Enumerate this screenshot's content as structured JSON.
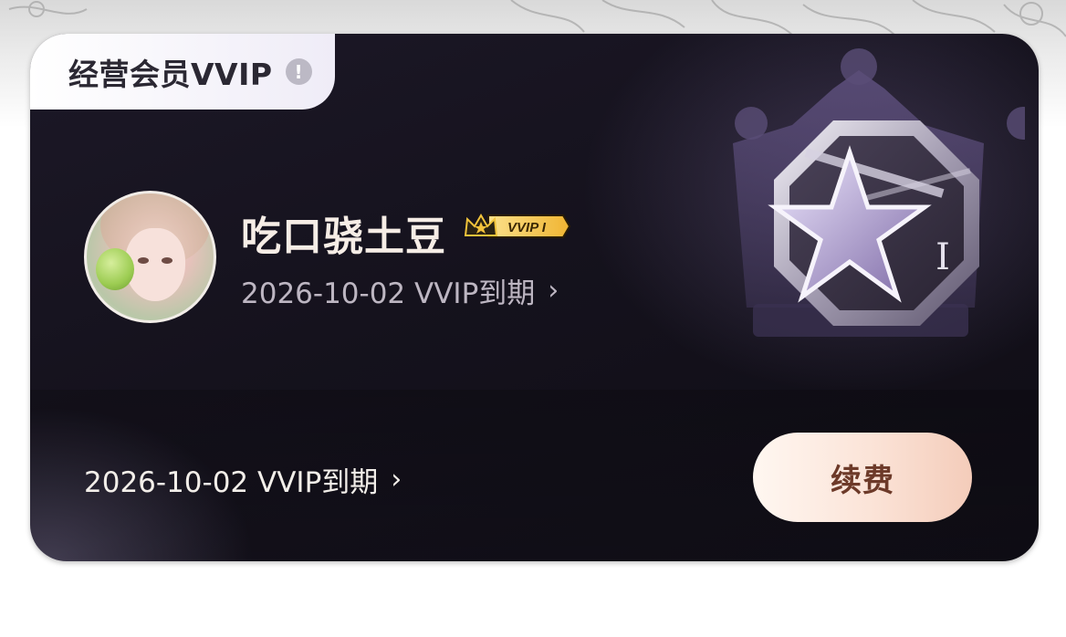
{
  "membership": {
    "tag_label": "经营会员VVIP",
    "tag_info_icon": "info-icon",
    "username": "吃口骁土豆",
    "badge_text": "VVIP I",
    "badge_icon": "crown-icon",
    "expiry_top": "2026-10-02 VVIP到期",
    "expiry_bottom": "2026-10-02 VVIP到期",
    "chevron": "›",
    "renew_label": "续费",
    "emblem_level": "I",
    "emblem_icon": "star-crown-emblem-icon"
  },
  "colors": {
    "card_bg": "#15121d",
    "tag_bg": "#f3f1f8",
    "renew_bg": "#fbe3d7",
    "renew_text": "#6d3a29",
    "badge_gold": "#f4c23c"
  }
}
